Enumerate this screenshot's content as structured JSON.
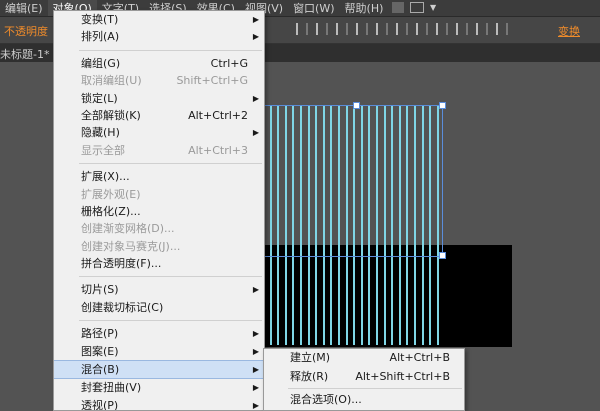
{
  "menubar": {
    "items": [
      "编辑(E)",
      "对象(O)",
      "文字(T)",
      "选择(S)",
      "效果(C)",
      "视图(V)",
      "窗口(W)",
      "帮助(H)"
    ]
  },
  "control_bar": {
    "opacity_label": "不透明度",
    "transform_label": "变换"
  },
  "document": {
    "tab_label": "未标题-1* @"
  },
  "object_menu": {
    "items": [
      {
        "label": "变换(T)",
        "submenu": true
      },
      {
        "label": "排列(A)",
        "submenu": true
      },
      {
        "sep": true
      },
      {
        "label": "编组(G)",
        "shortcut": "Ctrl+G"
      },
      {
        "label": "取消编组(U)",
        "shortcut": "Shift+Ctrl+G",
        "disabled": true
      },
      {
        "label": "锁定(L)",
        "submenu": true
      },
      {
        "label": "全部解锁(K)",
        "shortcut": "Alt+Ctrl+2"
      },
      {
        "label": "隐藏(H)",
        "submenu": true
      },
      {
        "label": "显示全部",
        "shortcut": "Alt+Ctrl+3",
        "disabled": true
      },
      {
        "sep": true
      },
      {
        "label": "扩展(X)..."
      },
      {
        "label": "扩展外观(E)",
        "disabled": true
      },
      {
        "label": "栅格化(Z)..."
      },
      {
        "label": "创建渐变网格(D)...",
        "disabled": true
      },
      {
        "label": "创建对象马赛克(J)...",
        "disabled": true
      },
      {
        "label": "拼合透明度(F)..."
      },
      {
        "sep": true
      },
      {
        "label": "切片(S)",
        "submenu": true
      },
      {
        "label": "创建裁切标记(C)"
      },
      {
        "sep": true
      },
      {
        "label": "路径(P)",
        "submenu": true
      },
      {
        "label": "图案(E)",
        "submenu": true
      },
      {
        "label": "混合(B)",
        "submenu": true,
        "highlighted": true
      },
      {
        "label": "封套扭曲(V)",
        "submenu": true
      },
      {
        "label": "透视(P)",
        "submenu": true
      }
    ]
  },
  "blend_submenu": {
    "items": [
      {
        "label": "建立(M)",
        "shortcut": "Alt+Ctrl+B"
      },
      {
        "label": "释放(R)",
        "shortcut": "Alt+Shift+Ctrl+B"
      },
      {
        "sep": true
      },
      {
        "label": "混合选项(O)..."
      }
    ]
  }
}
